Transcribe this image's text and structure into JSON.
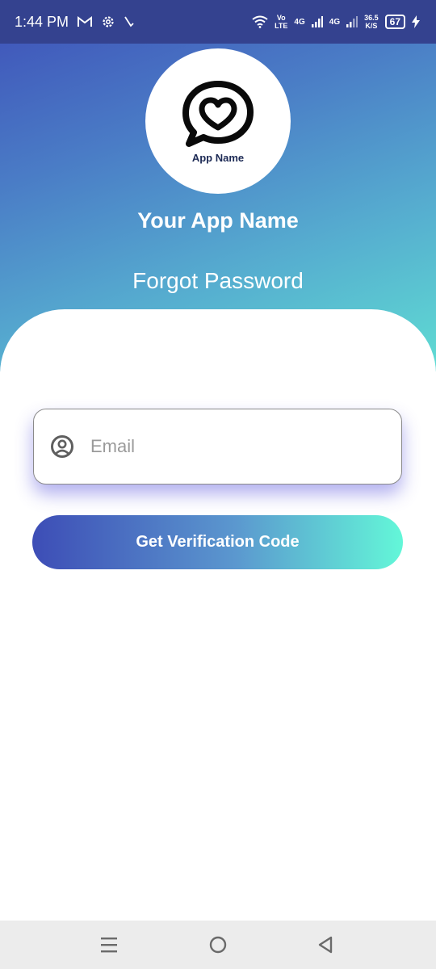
{
  "status_bar": {
    "time": "1:44 PM",
    "volte_top": "Vo",
    "volte_bottom": "LTE",
    "net1": "4G",
    "net2": "4G",
    "speed_value": "36.5",
    "speed_unit": "K/S",
    "battery": "67",
    "icons": [
      "gmail-icon",
      "settings-icon",
      "missed-call-icon",
      "wifi-icon",
      "signal-icon",
      "battery-icon",
      "charging-icon"
    ]
  },
  "logo": {
    "name": "App Name",
    "icon": "chat-heart-icon"
  },
  "app_title": "Your App Name",
  "page_title": "Forgot Password",
  "email_field": {
    "placeholder": "Email",
    "value": "",
    "icon": "user-circle-icon"
  },
  "verify_button": {
    "label": "Get Verification Code"
  },
  "nav_bar": {
    "items": [
      "menu-icon",
      "home-icon",
      "back-icon"
    ]
  },
  "colors": {
    "gradient_start": "#3e4fb8",
    "gradient_end": "#63f7d8",
    "status_bar": "#34428f"
  }
}
